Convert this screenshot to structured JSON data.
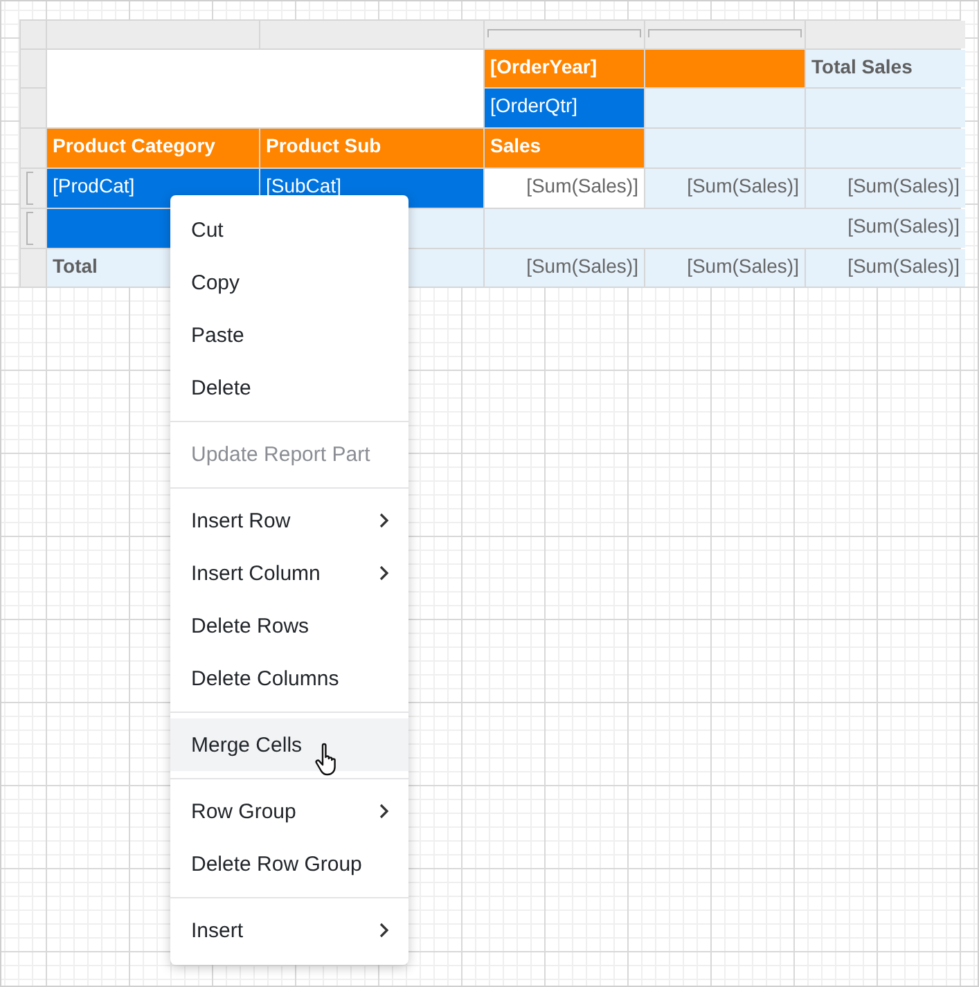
{
  "table": {
    "column_headers": [
      {
        "kind": "plain"
      },
      {
        "kind": "plain"
      },
      {
        "kind": "grouped"
      },
      {
        "kind": "grouped"
      },
      {
        "kind": "plain"
      }
    ],
    "row_headers": [
      {
        "kind": "plain"
      },
      {
        "kind": "plain"
      },
      {
        "kind": "plain"
      },
      {
        "kind": "grouped"
      },
      {
        "kind": "grouped"
      },
      {
        "kind": "plain"
      }
    ],
    "rows": [
      [
        {
          "kind": "blank",
          "colspan": 2,
          "rowspan": 2
        },
        {
          "kind": "header",
          "text": "[OrderYear]"
        },
        {
          "kind": "header"
        },
        {
          "kind": "label",
          "text": "Total Sales"
        }
      ],
      [
        {
          "kind": "field",
          "text": "[OrderQtr]"
        },
        {
          "kind": "light"
        },
        {
          "kind": "light"
        }
      ],
      [
        {
          "kind": "header",
          "text": "Product Category"
        },
        {
          "kind": "header",
          "text": "Product Sub"
        },
        {
          "kind": "header",
          "text": "Sales"
        },
        {
          "kind": "light"
        },
        {
          "kind": "light"
        }
      ],
      [
        {
          "kind": "field",
          "text": "[ProdCat]"
        },
        {
          "kind": "field",
          "text": "[SubCat]"
        },
        {
          "kind": "value",
          "text": "[Sum(Sales)]"
        },
        {
          "kind": "sum",
          "text": "[Sum(Sales)]"
        },
        {
          "kind": "sum",
          "text": "[Sum(Sales)]"
        }
      ],
      [
        {
          "kind": "field"
        },
        {
          "kind": "light"
        },
        {
          "kind": "sum",
          "colspan": 3,
          "text": "[Sum(Sales)]"
        }
      ],
      [
        {
          "kind": "label",
          "text": "Total"
        },
        {
          "kind": "light"
        },
        {
          "kind": "sum",
          "text": "[Sum(Sales)]"
        },
        {
          "kind": "sum",
          "text": "[Sum(Sales)]"
        },
        {
          "kind": "sum",
          "text": "[Sum(Sales)]"
        }
      ]
    ]
  },
  "context_menu": [
    {
      "kind": "item",
      "label": "Cut",
      "disabled": false,
      "highlighted": false,
      "submenu": false
    },
    {
      "kind": "item",
      "label": "Copy",
      "disabled": false,
      "highlighted": false,
      "submenu": false
    },
    {
      "kind": "item",
      "label": "Paste",
      "disabled": false,
      "highlighted": false,
      "submenu": false
    },
    {
      "kind": "item",
      "label": "Delete",
      "disabled": false,
      "highlighted": false,
      "submenu": false
    },
    {
      "kind": "separator"
    },
    {
      "kind": "item",
      "label": "Update Report Part",
      "disabled": true,
      "highlighted": false,
      "submenu": false
    },
    {
      "kind": "separator"
    },
    {
      "kind": "item",
      "label": "Insert Row",
      "disabled": false,
      "highlighted": false,
      "submenu": true
    },
    {
      "kind": "item",
      "label": "Insert Column",
      "disabled": false,
      "highlighted": false,
      "submenu": true
    },
    {
      "kind": "item",
      "label": "Delete Rows",
      "disabled": false,
      "highlighted": false,
      "submenu": false
    },
    {
      "kind": "item",
      "label": "Delete Columns",
      "disabled": false,
      "highlighted": false,
      "submenu": false
    },
    {
      "kind": "separator"
    },
    {
      "kind": "item",
      "label": "Merge Cells",
      "disabled": false,
      "highlighted": true,
      "submenu": false
    },
    {
      "kind": "separator"
    },
    {
      "kind": "item",
      "label": "Row Group",
      "disabled": false,
      "highlighted": false,
      "submenu": true
    },
    {
      "kind": "item",
      "label": "Delete Row Group",
      "disabled": false,
      "highlighted": false,
      "submenu": false
    },
    {
      "kind": "separator"
    },
    {
      "kind": "item",
      "label": "Insert",
      "disabled": false,
      "highlighted": false,
      "submenu": true
    }
  ]
}
